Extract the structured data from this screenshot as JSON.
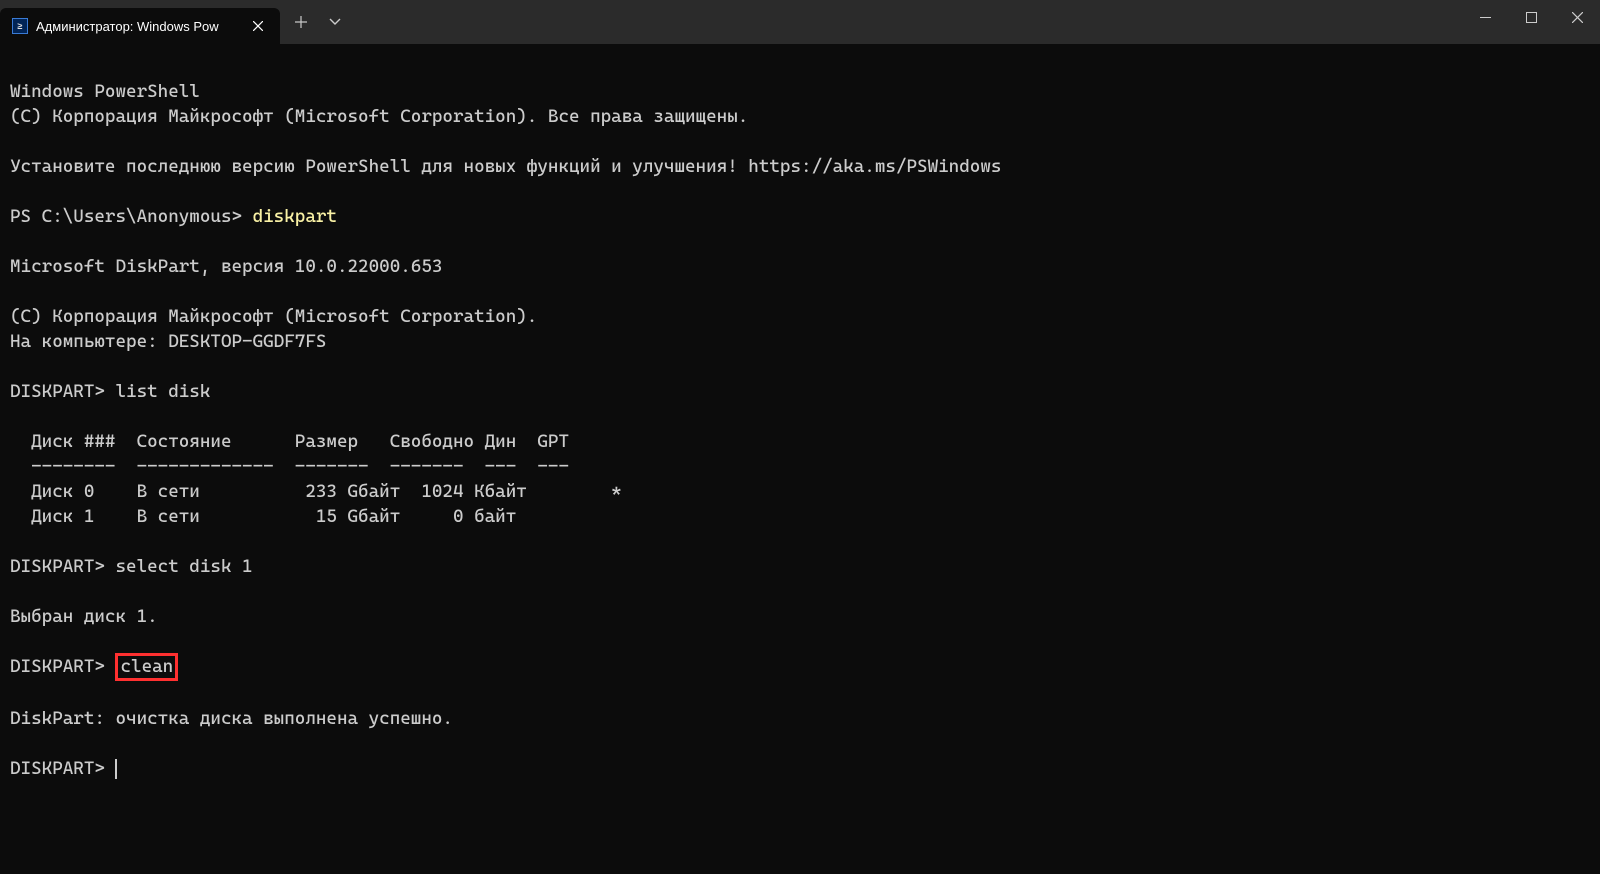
{
  "titlebar": {
    "tab_title": "Администратор: Windows Pow",
    "icon_label": "≥"
  },
  "terminal": {
    "line1": "Windows PowerShell",
    "line2": "(C) Корпорация Майкрософт (Microsoft Corporation). Все права защищены.",
    "line3": "Установите последнюю версию PowerShell для новых функций и улучшения! https://aka.ms/PSWindows",
    "prompt1_prefix": "PS C:\\Users\\Anonymous> ",
    "prompt1_cmd": "diskpart",
    "dp1": "Microsoft DiskPart, версия 10.0.22000.653",
    "dp2": "(C) Корпорация Майкрософт (Microsoft Corporation).",
    "dp3": "На компьютере: DESKTOP-GGDF7FS",
    "dp_prompt1": "DISKPART> list disk",
    "table_header": "  Диск ###  Состояние      Размер   Свободно Дин  GPT",
    "table_sep": "  --------  -------------  -------  -------  ---  ---",
    "table_row0": "  Диск 0    В сети          233 Gбайт  1024 Кбайт        *",
    "table_row1": "  Диск 1    В сети           15 Gбайт     0 байт",
    "dp_prompt2": "DISKPART> select disk 1",
    "dp_selected": "Выбран диск 1.",
    "dp_prompt3_prefix": "DISKPART> ",
    "dp_prompt3_cmd": "clean",
    "dp_result": "DiskPart: очистка диска выполнена успешно.",
    "dp_prompt4": "DISKPART> "
  }
}
